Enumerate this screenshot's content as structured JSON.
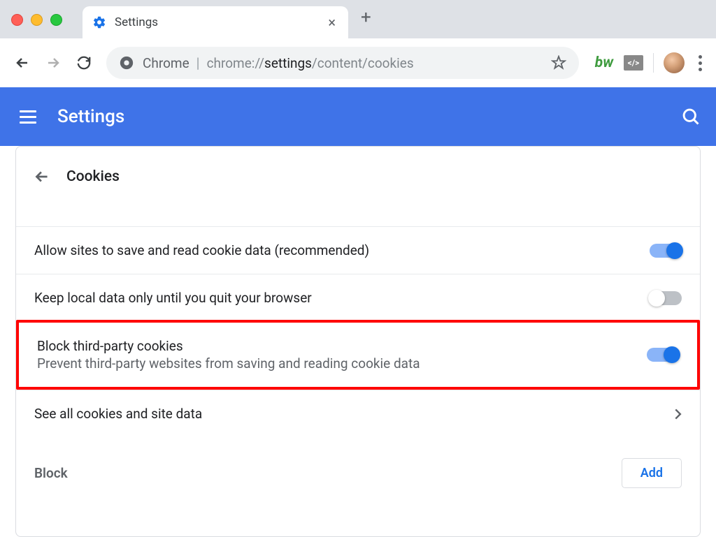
{
  "browser": {
    "tab_title": "Settings",
    "omnibox_prefix": "Chrome",
    "omnibox_url_prefix": "chrome://",
    "omnibox_url_bold": "settings",
    "omnibox_url_suffix": "/content/cookies"
  },
  "app": {
    "title": "Settings",
    "section": "Cookies"
  },
  "settings": {
    "allow_cookies": {
      "label": "Allow sites to save and read cookie data (recommended)",
      "on": true
    },
    "keep_local": {
      "label": "Keep local data only until you quit your browser",
      "on": false
    },
    "block_third": {
      "label": "Block third-party cookies",
      "desc": "Prevent third-party websites from saving and reading cookie data",
      "on": true
    },
    "see_all": {
      "label": "See all cookies and site data"
    }
  },
  "block_section": {
    "label": "Block",
    "add_label": "Add"
  }
}
